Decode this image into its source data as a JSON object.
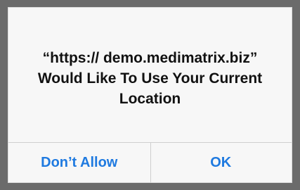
{
  "dialog": {
    "message": "“https:// demo.medimatrix.biz” Would Like To Use Your Current Location",
    "buttons": {
      "dont_allow": "Don’t Allow",
      "ok": "OK"
    }
  },
  "colors": {
    "background_frame": "#6b6b6b",
    "dialog_bg": "#f7f7f7",
    "divider": "#cfcfcf",
    "button_text": "#1f7ae0",
    "message_text": "#111111"
  }
}
